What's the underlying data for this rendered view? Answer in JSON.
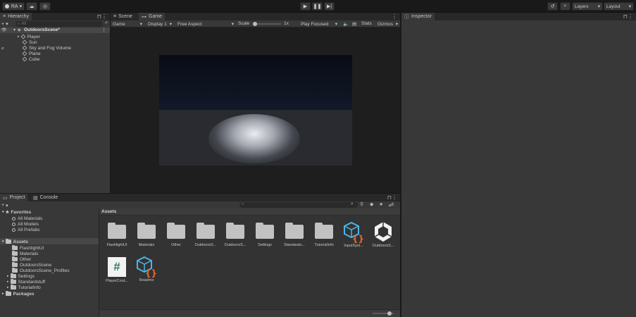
{
  "toolbar": {
    "account": "RA",
    "layers": "Layers",
    "layout": "Layout"
  },
  "hierarchy": {
    "tab": "Hierarchy",
    "search_placeholder": "All",
    "scene": "OutdoorsScene*",
    "items": [
      "Player",
      "Sun",
      "Sky and Fog Volume",
      "Plane",
      "Cube"
    ]
  },
  "center": {
    "tabs": [
      "Scene",
      "Game"
    ],
    "game_dropdown": "Game",
    "display": "Display 1",
    "aspect": "Free Aspect",
    "scale_label": "Scale",
    "scale_value": "1x",
    "play_focused": "Play Focused",
    "stats": "Stats",
    "gizmos": "Gizmos"
  },
  "inspector": {
    "tab": "Inspector"
  },
  "bottom": {
    "tabs": [
      "Project",
      "Console"
    ],
    "badge": "8",
    "favorites_label": "Favorites",
    "favorites": [
      "All Materials",
      "All Models",
      "All Prefabs"
    ],
    "assets_label": "Assets",
    "asset_folders": [
      "FlashlightUI",
      "Materials",
      "Other",
      "OutdoorsScene",
      "OutdoorsScene_Profiles",
      "Settings",
      "Standardstuff",
      "TutorialInfo"
    ],
    "packages_label": "Packages",
    "breadcrumb": "Assets",
    "grid": [
      {
        "name": "FlashlightUI",
        "kind": "folder"
      },
      {
        "name": "Materials",
        "kind": "folder"
      },
      {
        "name": "Other",
        "kind": "folder"
      },
      {
        "name": "OutdoorsS...",
        "kind": "folder"
      },
      {
        "name": "OutdoorsS...",
        "kind": "folder"
      },
      {
        "name": "Settings",
        "kind": "folder"
      },
      {
        "name": "Standards...",
        "kind": "folder"
      },
      {
        "name": "TutorialInfo",
        "kind": "folder"
      },
      {
        "name": "InputSyst...",
        "kind": "inputsystem"
      },
      {
        "name": "OutdoorsS...",
        "kind": "unity"
      },
      {
        "name": "PlayerCont...",
        "kind": "script"
      },
      {
        "name": "Readme",
        "kind": "readme"
      }
    ],
    "zoom_slider": 0.8
  },
  "colors": {
    "accent": "#2c5d87",
    "panel": "#383838",
    "dark": "#191919",
    "orange": "#e7692a",
    "cyan": "#4bb5e6",
    "script_green": "#2e7d5b"
  }
}
